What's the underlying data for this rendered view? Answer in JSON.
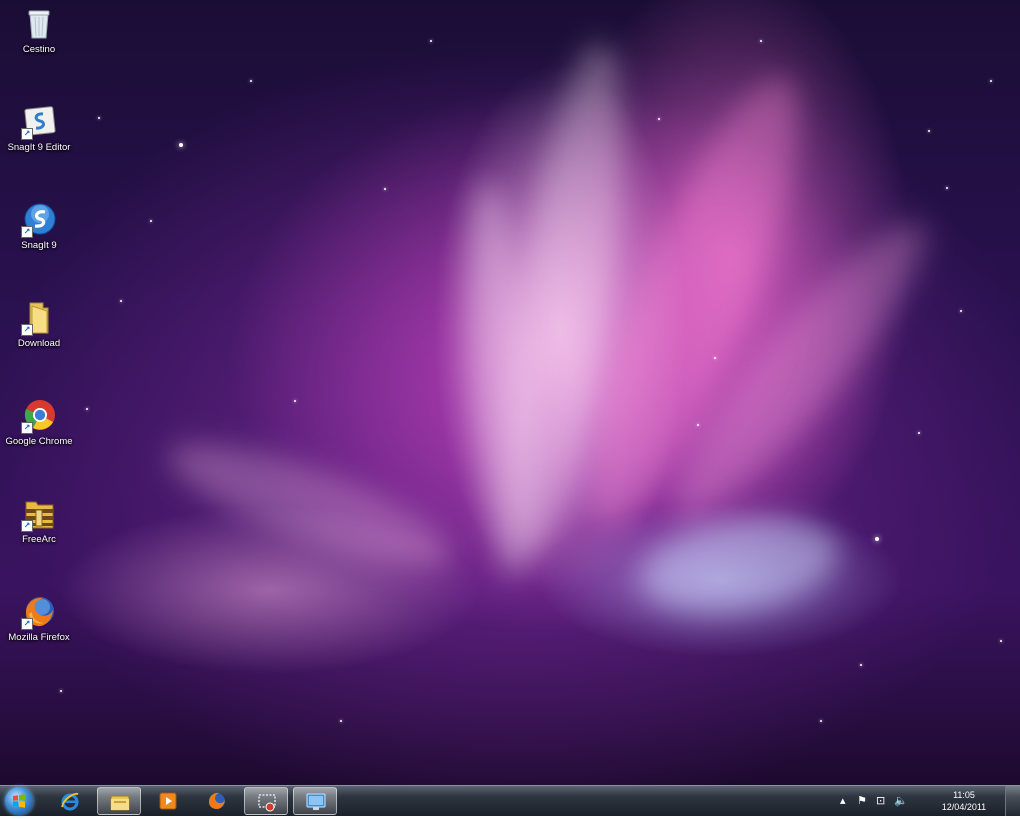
{
  "desktop": {
    "icons": [
      {
        "label": "Cestino",
        "icon": "recycle-bin-icon"
      },
      {
        "label": "SnagIt 9 Editor",
        "icon": "snagit-editor-icon"
      },
      {
        "label": "SnagIt 9",
        "icon": "snagit-icon"
      },
      {
        "label": "Download",
        "icon": "folder-icon"
      },
      {
        "label": "Google Chrome",
        "icon": "chrome-icon"
      },
      {
        "label": "FreeArc",
        "icon": "freearc-icon"
      },
      {
        "label": "Mozilla Firefox",
        "icon": "firefox-icon"
      }
    ],
    "wallpaper_colors": {
      "base": "#2a1150",
      "pink": "#c846be",
      "light": "#ffe1f5"
    }
  },
  "taskbar": {
    "pinned": [
      {
        "icon": "internet-explorer-icon"
      },
      {
        "icon": "windows-explorer-icon",
        "active": true
      },
      {
        "icon": "media-player-icon"
      },
      {
        "icon": "firefox-icon"
      },
      {
        "icon": "snagit-capture-icon",
        "active": true
      },
      {
        "icon": "remote-desktop-icon",
        "active": true
      }
    ],
    "tray": {
      "show_hidden": "▴",
      "flag": "⚑",
      "network": "⊡",
      "volume": "🔈"
    },
    "clock": {
      "time": "11:05",
      "date": "12/04/2011"
    }
  }
}
